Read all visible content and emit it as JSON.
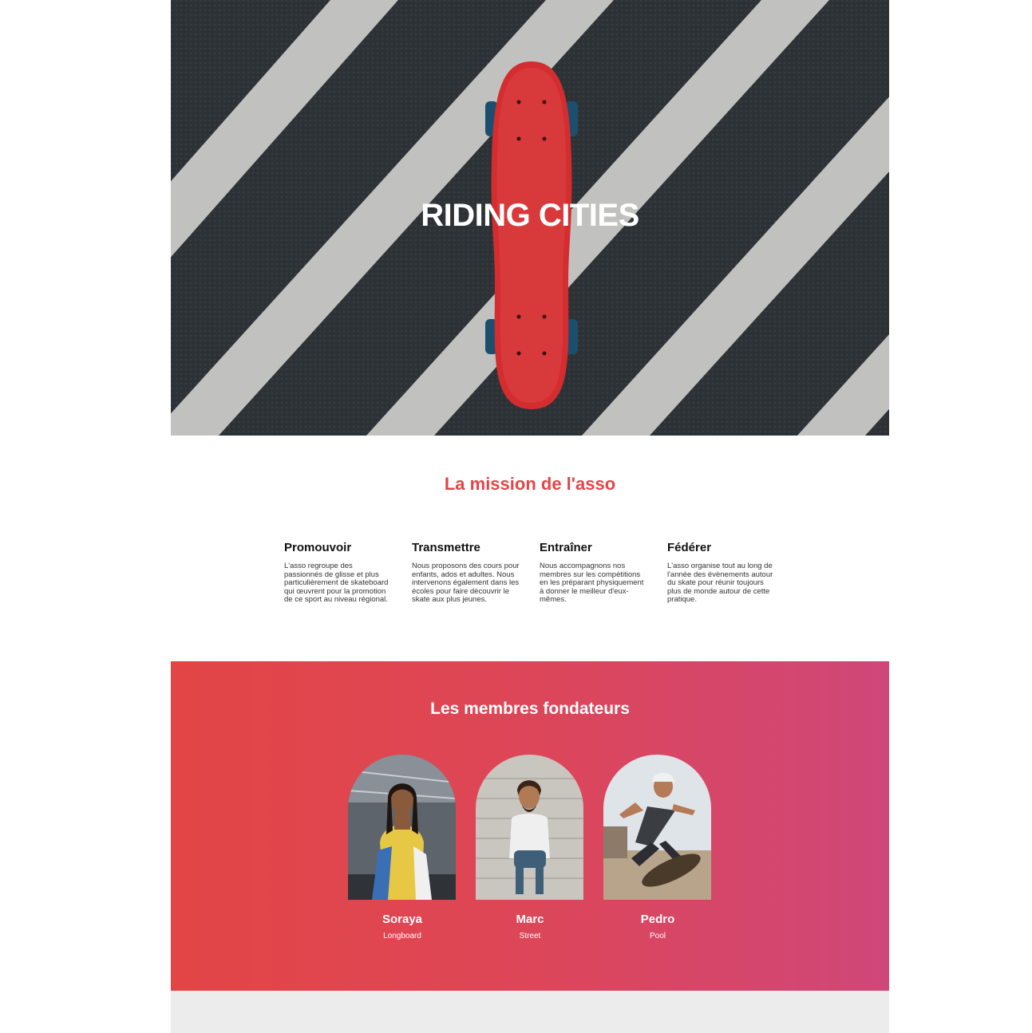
{
  "hero": {
    "title": "RIDING CITIES"
  },
  "mission": {
    "title": "La mission de l'asso",
    "items": [
      {
        "title": "Promouvoir",
        "text": "L'asso regroupe des passionnés de glisse et plus particulièrement de skateboard qui œuvrent pour la promotion de ce sport au niveau régional."
      },
      {
        "title": "Transmettre",
        "text": "Nous proposons des cours pour enfants, ados et adultes. Nous intervenons également dans les écoles pour faire découvrir le skate aux plus jeunes."
      },
      {
        "title": "Entraîner",
        "text": "Nous accompagnons nos membres sur les compétitions en les préparant physiquement à donner le meilleur d'eux-mêmes."
      },
      {
        "title": "Fédérer",
        "text": "L'asso organise tout au long de l'année des évènements autour du skate pour réunir toujours plus de monde autour de cette pratique."
      }
    ]
  },
  "members": {
    "title": "Les membres fondateurs",
    "list": [
      {
        "name": "Soraya",
        "role": "Longboard"
      },
      {
        "name": "Marc",
        "role": "Street"
      },
      {
        "name": "Pedro",
        "role": "Pool"
      }
    ]
  },
  "colors": {
    "accent": "#e34547",
    "gradient_start": "#e34545",
    "gradient_end": "#cf4779",
    "footer_band": "#ececec"
  }
}
